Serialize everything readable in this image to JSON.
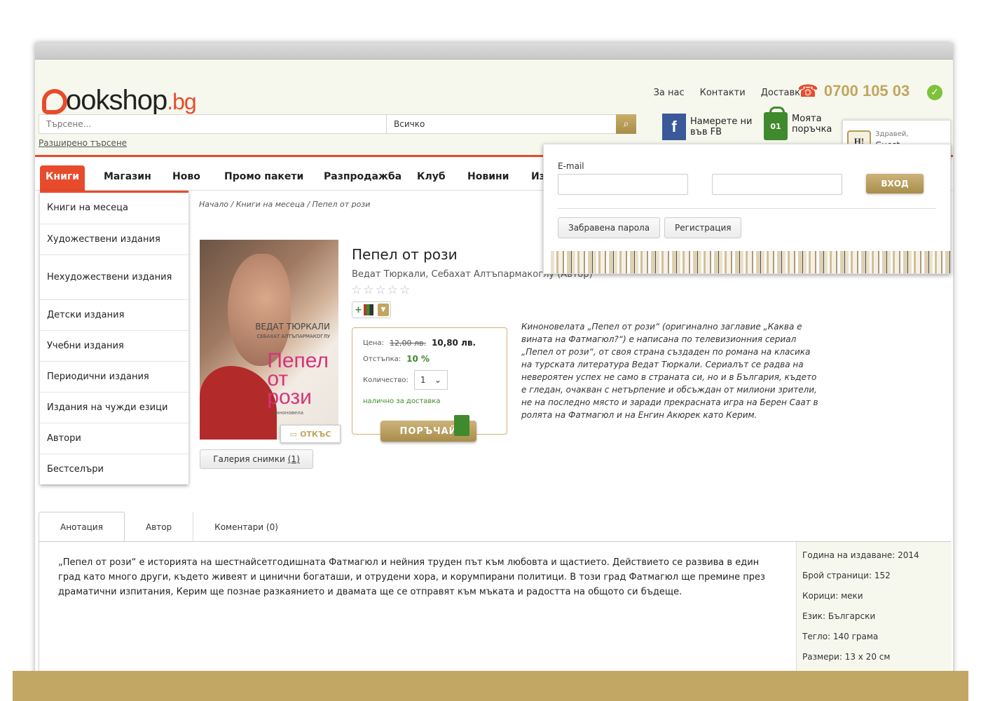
{
  "header": {
    "logo_main": "ookshop",
    "logo_tld": ".bg",
    "links": [
      "За нас",
      "Контакти",
      "Доставка"
    ],
    "phone": "0700 105 03",
    "search_placeholder": "Търсене...",
    "search_category": "Всичко",
    "advanced_search": "Разширено търсене",
    "fb_line1": "Намерете ни",
    "fb_line2": "във FB",
    "order_badge": "01",
    "order_line1": "Моята",
    "order_line2": "поръчка",
    "hello_badge": "H!",
    "hello_small": "Здравей,",
    "hello_name": "Guest"
  },
  "nav": [
    "Книги",
    "Магазин",
    "Ново",
    "Промо пакети",
    "Разпродажба",
    "Клуб",
    "Новини",
    "Из"
  ],
  "dropdown": [
    "Книги на месеца",
    "Художествени издания",
    "Нехудожествени издания",
    "Детски издания",
    "Учебни издания",
    "Периодични издания",
    "Издания на чужди езици",
    "Автори",
    "Бестселъри"
  ],
  "breadcrumb": "Начало / Книги на месеца / Пепел от рози",
  "book": {
    "cover_author": "ВЕДАТ ТЮРКАЛИ",
    "cover_author2": "СЕБАХАТ АЛТЪПАРМАКОГЛУ",
    "cover_title_1": "Пепел",
    "cover_title_2": "от",
    "cover_title_3": "рози",
    "cover_sub": "киноновела",
    "peek": "ОТКЪС",
    "gallery": "Галерия снимки",
    "gallery_count": "(1)",
    "title": "Пепел от рози",
    "author": "Ведат Тюркали, Себахат Алтъпармакоглу (Автор)",
    "rating": "☆☆☆☆☆",
    "price_label": "Цена:",
    "old_price": "12,00 лв.",
    "new_price": "10,80 лв.",
    "discount_label": "Отстъпка:",
    "discount": "10 %",
    "qty_label": "Количество:",
    "qty": "1",
    "availability": "налично за доставка",
    "order_button": "ПОРЪЧАЙ",
    "description": "Киноновелата „Пепел от рози“ (оригинално заглавие „Каква е вината на Фатмагюл?“) е написана по телевизионния сериал „Пепел от рози“, от своя страна създаден по романа на класика на турската литература Ведат Тюркали. Сериалът се радва на невероятен успех не само в страната си, но и в България, където е гледан, очакван с нетърпение и обсъждан от милиони зрители, не на последно място и заради прекрасната игра на Берен Саат в ролята на Фатмагюл и на Енгин Акюрек като Керим."
  },
  "tabs": [
    "Анотация",
    "Автор",
    "Коментари (0)"
  ],
  "annotation": "„Пепел от рози“ е историята на шестнайсетгодишната Фатмагюл и нейния труден път към любовта и щастието. Действието се развива в един град като много други, където живеят и цинични богаташи, и отрудени хора, и корумпирани политици. В този град Фатмагюл ще премине през драматични изпитания, Керим ще познае разкаянието и двамата ще се отправят към мъката и радостта на общото си бъдеще.",
  "specs": [
    "Година на издаване:  2014",
    "Брой страници:  152",
    "Корици:  меки",
    "Език:  Български",
    "Тегло:  140 грама",
    "Размери:  13 x 20 см"
  ],
  "login": {
    "email_label": "E-mail",
    "submit": "ВХОД",
    "forgot": "Забравена парола",
    "register": "Регистрация"
  },
  "colors": {
    "accent": "#e84b2b",
    "gold": "#c2a764",
    "green": "#3f8a2c"
  }
}
